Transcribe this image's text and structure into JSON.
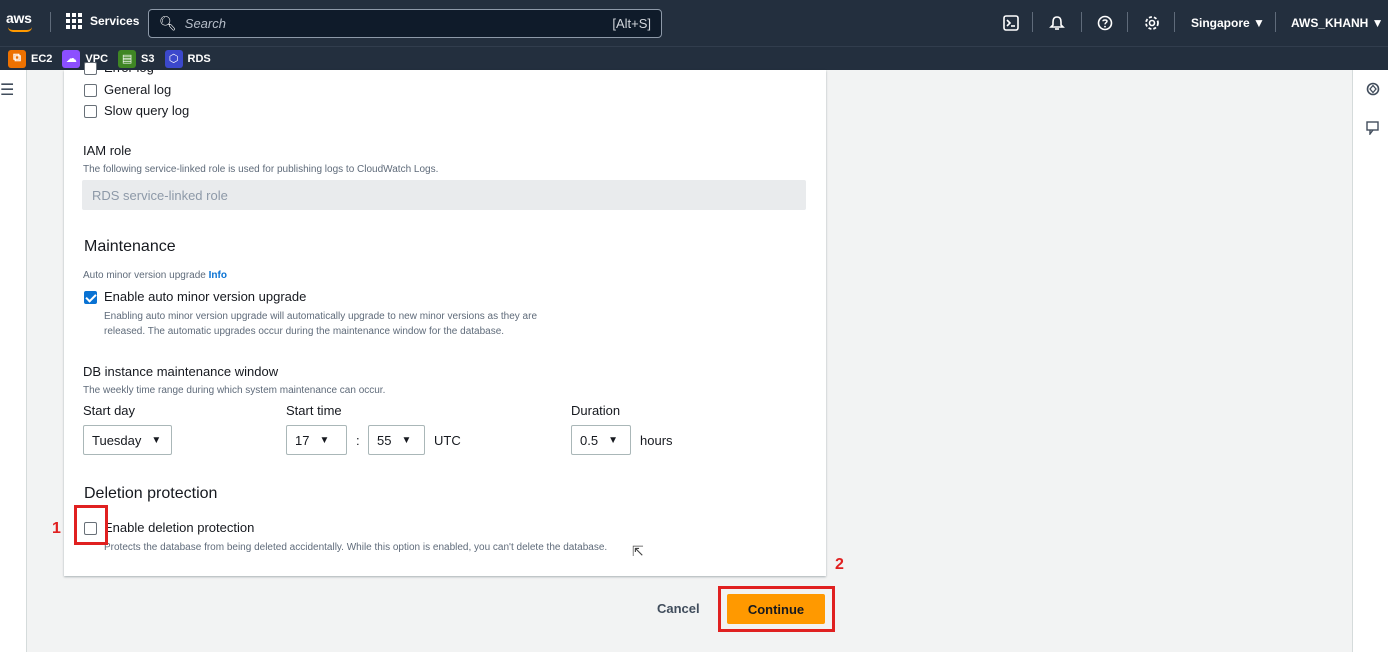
{
  "nav": {
    "logo": "aws",
    "services": "Services",
    "search_placeholder": "Search",
    "search_shortcut": "[Alt+S]",
    "region": "Singapore ▼",
    "account": "AWS_KHANH ▼"
  },
  "shortcuts": [
    {
      "label": "EC2",
      "color": "#ed7100"
    },
    {
      "label": "VPC",
      "color": "#8c4fff"
    },
    {
      "label": "S3",
      "color": "#3f8624"
    },
    {
      "label": "RDS",
      "color": "#3b48cc"
    }
  ],
  "logs": {
    "partial_item": "Error log",
    "general": "General log",
    "slow_query": "Slow query log"
  },
  "iam": {
    "title": "IAM role",
    "description": "The following service-linked role is used for publishing logs to CloudWatch Logs.",
    "field_value": "RDS service-linked role"
  },
  "maintenance": {
    "heading": "Maintenance",
    "auto_minor_label": "Auto minor version upgrade",
    "info": "Info",
    "enable_auto_label": "Enable auto minor version upgrade",
    "enable_auto_desc_1": "Enabling auto minor version upgrade will automatically upgrade to new minor versions as they are",
    "enable_auto_desc_2": "released. The automatic upgrades occur during the maintenance window for the database.",
    "window_title": "DB instance maintenance window",
    "window_desc": "The weekly time range during which system maintenance can occur.",
    "start_day_label": "Start day",
    "start_day_value": "Tuesday",
    "start_time_label": "Start time",
    "hour_value": "17",
    "colon": ":",
    "minute_value": "55",
    "utc": "UTC",
    "duration_label": "Duration",
    "duration_value": "0.5",
    "hours": "hours"
  },
  "deletion": {
    "heading": "Deletion protection",
    "label": "Enable deletion protection",
    "description": "Protects the database from being deleted accidentally. While this option is enabled, you can't delete the database."
  },
  "actions": {
    "cancel": "Cancel",
    "continue": "Continue"
  },
  "annotations": {
    "step1": "1",
    "step2": "2"
  }
}
